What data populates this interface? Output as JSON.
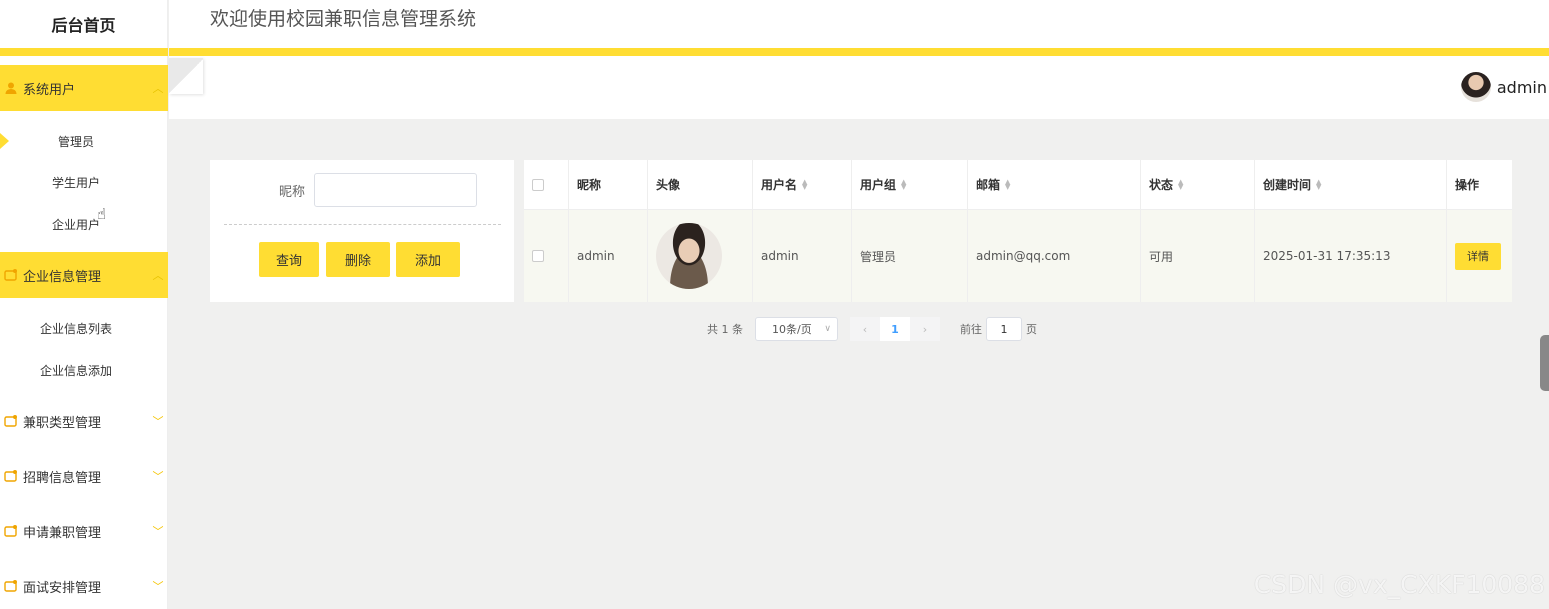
{
  "sidebar": {
    "brand": "后台首页",
    "groups": [
      {
        "label": "系统用户",
        "icon": "user-icon",
        "expanded": true,
        "active": true,
        "items": [
          "管理员",
          "学生用户",
          "企业用户"
        ],
        "selected": "管理员"
      },
      {
        "label": "企业信息管理",
        "icon": "folder-icon",
        "expanded": true,
        "active": true,
        "items": [
          "企业信息列表",
          "企业信息添加"
        ]
      },
      {
        "label": "兼职类型管理",
        "icon": "folder-icon",
        "expanded": false
      },
      {
        "label": "招聘信息管理",
        "icon": "folder-icon",
        "expanded": false
      },
      {
        "label": "申请兼职管理",
        "icon": "folder-icon",
        "expanded": false
      },
      {
        "label": "面试安排管理",
        "icon": "folder-icon",
        "expanded": false
      }
    ]
  },
  "header": {
    "title": "欢迎使用校园兼职信息管理系统",
    "user": "admin"
  },
  "search": {
    "label": "昵称",
    "value": "",
    "buttons": {
      "query": "查询",
      "delete": "删除",
      "add": "添加"
    }
  },
  "table": {
    "columns": [
      "昵称",
      "头像",
      "用户名",
      "用户组",
      "邮箱",
      "状态",
      "创建时间",
      "操作"
    ],
    "rows": [
      {
        "nickname": "admin",
        "avatar": "avatar-image",
        "username": "admin",
        "group": "管理员",
        "email": "admin@qq.com",
        "status": "可用",
        "created": "2025-01-31 17:35:13",
        "action": "详情"
      }
    ]
  },
  "pagination": {
    "total": "共 1 条",
    "page_size": "10条/页",
    "current": "1",
    "goto_label": "前往",
    "goto_value": "1",
    "page_suffix": "页"
  },
  "watermark": "CSDN @vx_CXKF10088",
  "colors": {
    "accent": "#ffdd33",
    "page_bg": "#f0f0ef",
    "link": "#409eff"
  }
}
